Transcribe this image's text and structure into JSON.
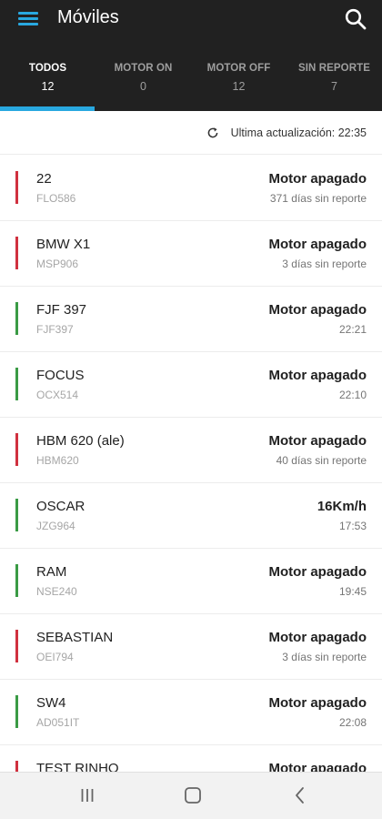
{
  "header": {
    "title": "Móviles",
    "menu_icon": "hamburger-menu-icon",
    "search_icon": "search-icon"
  },
  "tabs": [
    {
      "label": "TODOS",
      "count": "12",
      "active": true
    },
    {
      "label": "MOTOR ON",
      "count": "0",
      "active": false
    },
    {
      "label": "MOTOR OFF",
      "count": "12",
      "active": false
    },
    {
      "label": "SIN REPORTE",
      "count": "7",
      "active": false
    }
  ],
  "update": {
    "text": "Ultima actualización: 22:35",
    "icon": "refresh-icon"
  },
  "vehicles": [
    {
      "name": "22",
      "plate": "FLO586",
      "status": "Motor apagado",
      "time": "371 días sin reporte",
      "indicator": "red"
    },
    {
      "name": "BMW X1",
      "plate": "MSP906",
      "status": "Motor apagado",
      "time": "3 días sin reporte",
      "indicator": "red"
    },
    {
      "name": "FJF 397",
      "plate": "FJF397",
      "status": "Motor apagado",
      "time": "22:21",
      "indicator": "green"
    },
    {
      "name": "FOCUS",
      "plate": "OCX514",
      "status": "Motor apagado",
      "time": "22:10",
      "indicator": "green"
    },
    {
      "name": "HBM 620 (ale)",
      "plate": "HBM620",
      "status": "Motor apagado",
      "time": "40 días sin reporte",
      "indicator": "red"
    },
    {
      "name": "OSCAR",
      "plate": "JZG964",
      "status": "16Km/h",
      "time": "17:53",
      "indicator": "green"
    },
    {
      "name": "RAM",
      "plate": "NSE240",
      "status": "Motor apagado",
      "time": "19:45",
      "indicator": "green"
    },
    {
      "name": "SEBASTIAN",
      "plate": "OEI794",
      "status": "Motor apagado",
      "time": "3 días sin reporte",
      "indicator": "red"
    },
    {
      "name": "SW4",
      "plate": "AD051IT",
      "status": "Motor apagado",
      "time": "22:08",
      "indicator": "green"
    },
    {
      "name": "TEST RINHO",
      "plate": "",
      "status": "Motor apagado",
      "time": "",
      "indicator": "red"
    }
  ],
  "colors": {
    "accent": "#29a8e0",
    "appbar": "#212121",
    "red": "#d0313f",
    "green": "#3a9b45"
  },
  "navbar": {
    "recents_icon": "recents-icon",
    "home_icon": "home-icon",
    "back_icon": "back-icon"
  }
}
